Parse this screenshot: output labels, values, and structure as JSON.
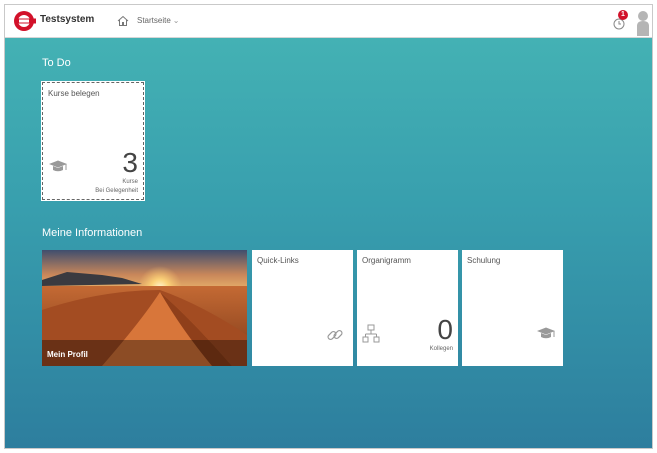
{
  "shell": {
    "app_title": "Testsystem",
    "nav_label": "Startseite",
    "notification_count": "1",
    "icons": [
      "company-logo-icon",
      "home-icon",
      "chevron-down-icon",
      "notifications-icon",
      "user-avatar-icon"
    ]
  },
  "sections": {
    "todo_title": "To Do",
    "info_title": "Meine Informationen"
  },
  "tiles": {
    "todo": {
      "title": "Kurse belegen",
      "value": "3",
      "unit": "Kurse",
      "info": "Bei Gelegenheit",
      "icon": "graduation-cap-icon"
    },
    "profile": {
      "title": "Mein Profil"
    },
    "quicklinks": {
      "title": "Quick-Links",
      "icon": "link-icon"
    },
    "organigramm": {
      "title": "Organigramm",
      "value": "0",
      "unit": "Kollegen",
      "icon": "org-chart-icon"
    },
    "schulung": {
      "title": "Schulung",
      "icon": "graduation-cap-icon"
    }
  },
  "colors": {
    "background_top": "#46b5b5",
    "background_bottom": "#2d7e9e",
    "brand_red": "#d2112a"
  }
}
